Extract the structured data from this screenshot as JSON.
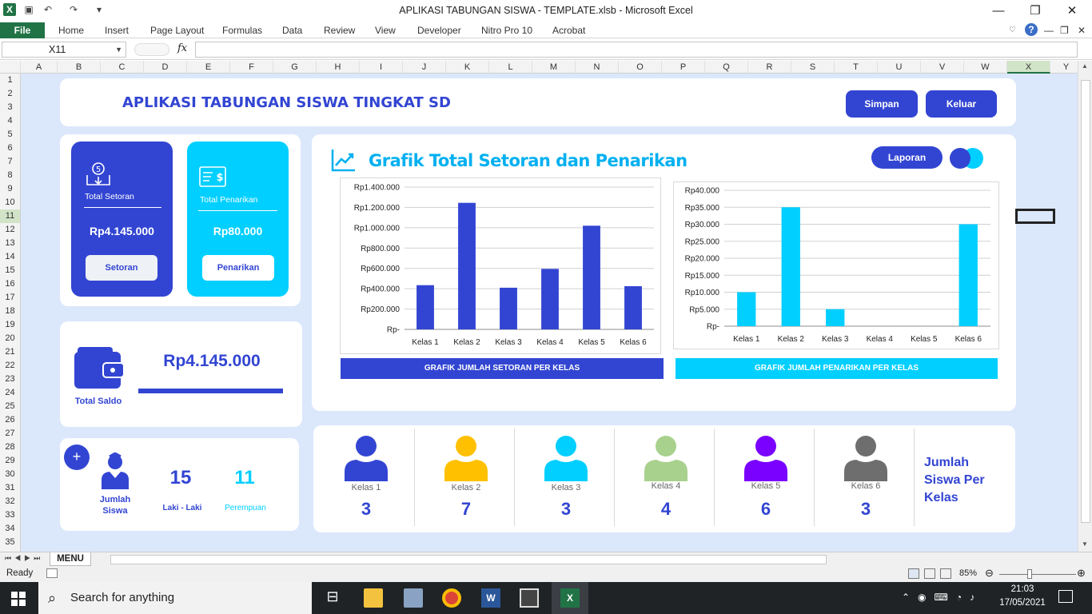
{
  "window": {
    "title": "APLIKASI TABUNGAN SISWA - TEMPLATE.xlsb  -  Microsoft Excel",
    "controls": {
      "minimize": "—",
      "restore": "❐",
      "close": "✕"
    }
  },
  "ribbon": {
    "file": "File",
    "tabs": [
      "Home",
      "Insert",
      "Page Layout",
      "Formulas",
      "Data",
      "Review",
      "View",
      "Developer",
      "Nitro Pro 10",
      "Acrobat"
    ]
  },
  "formula_bar": {
    "name_box": "X11",
    "fx": "fx",
    "value": ""
  },
  "columns": [
    "A",
    "B",
    "C",
    "D",
    "E",
    "F",
    "G",
    "H",
    "I",
    "J",
    "K",
    "L",
    "M",
    "N",
    "O",
    "P",
    "Q",
    "R",
    "S",
    "T",
    "U",
    "V",
    "W",
    "X",
    "Y"
  ],
  "rows": [
    "1",
    "2",
    "3",
    "4",
    "5",
    "6",
    "7",
    "8",
    "9",
    "10",
    "11",
    "12",
    "13",
    "14",
    "15",
    "16",
    "17",
    "18",
    "19",
    "20",
    "21",
    "22",
    "23",
    "24",
    "25",
    "26",
    "27",
    "28",
    "29",
    "30",
    "31",
    "32",
    "33",
    "34",
    "35"
  ],
  "dashboard": {
    "app_title": "APLIKASI TABUNGAN SISWA TINGKAT SD",
    "save_button": "Simpan",
    "exit_button": "Keluar",
    "setoran": {
      "label": "Total  Setoran",
      "amount": "Rp4.145.000",
      "button": "Setoran"
    },
    "penarikan": {
      "label": "Total  Penarikan",
      "amount": "Rp80.000",
      "button": "Penarikan"
    },
    "saldo": {
      "label": "Total Saldo",
      "amount": "Rp4.145.000"
    },
    "siswa": {
      "plus": "+",
      "label_line1": "Jumlah",
      "label_line2": "Siswa",
      "laki_count": "15",
      "laki_label": "Laki - Laki",
      "perempuan_count": "11",
      "perempuan_label": "Perempuan"
    },
    "grafik": {
      "title": "Grafik Total Setoran dan Penarikan",
      "report_button": "Laporan"
    },
    "chart_captions": {
      "setoran": "GRAFIK  JUMLAH  SETORAN  PER KELAS",
      "penarikan": "GRAFIK  JUMLAH  PENARIKAN  PER  KELAS"
    },
    "kelas": [
      {
        "label": "Kelas 1",
        "count": "3",
        "color": "#3245d2"
      },
      {
        "label": "Kelas 2",
        "count": "7",
        "color": "#ffc000"
      },
      {
        "label": "Kelas 3",
        "count": "3",
        "color": "#00cfff"
      },
      {
        "label": "Kelas 4",
        "count": "4",
        "color": "#a9d18e"
      },
      {
        "label": "Kelas 5",
        "count": "6",
        "color": "#7a00ff"
      },
      {
        "label": "Kelas 6",
        "count": "3",
        "color": "#6e6e6e"
      }
    ],
    "jumlah_caption": [
      "Jumlah",
      "Siswa Per",
      "Kelas"
    ]
  },
  "chart_data": [
    {
      "type": "bar",
      "categories": [
        "Kelas 1",
        "Kelas 2",
        "Kelas 3",
        "Kelas 4",
        "Kelas 5",
        "Kelas 6"
      ],
      "values": [
        435000,
        1245000,
        410000,
        595000,
        1020000,
        425000
      ],
      "ylim": [
        0,
        1400000
      ],
      "yticks": [
        "Rp-",
        "Rp200.000",
        "Rp400.000",
        "Rp600.000",
        "Rp800.000",
        "Rp1.000.000",
        "Rp1.200.000",
        "Rp1.400.000"
      ],
      "color": "#3245d2",
      "grid": true
    },
    {
      "type": "bar",
      "categories": [
        "Kelas 1",
        "Kelas 2",
        "Kelas 3",
        "Kelas 4",
        "Kelas 5",
        "Kelas 6"
      ],
      "values": [
        10000,
        35000,
        5000,
        0,
        0,
        30000
      ],
      "ylim": [
        0,
        40000
      ],
      "yticks": [
        "Rp-",
        "Rp5.000",
        "Rp10.000",
        "Rp15.000",
        "Rp20.000",
        "Rp25.000",
        "Rp30.000",
        "Rp35.000",
        "Rp40.000"
      ],
      "color": "#00cfff",
      "grid": true
    }
  ],
  "sheet_tabs": {
    "active": "MENU"
  },
  "status": {
    "ready": "Ready",
    "zoom": "85%"
  },
  "taskbar": {
    "search": "Search for anything",
    "time": "21:03",
    "date": "17/05/2021"
  }
}
